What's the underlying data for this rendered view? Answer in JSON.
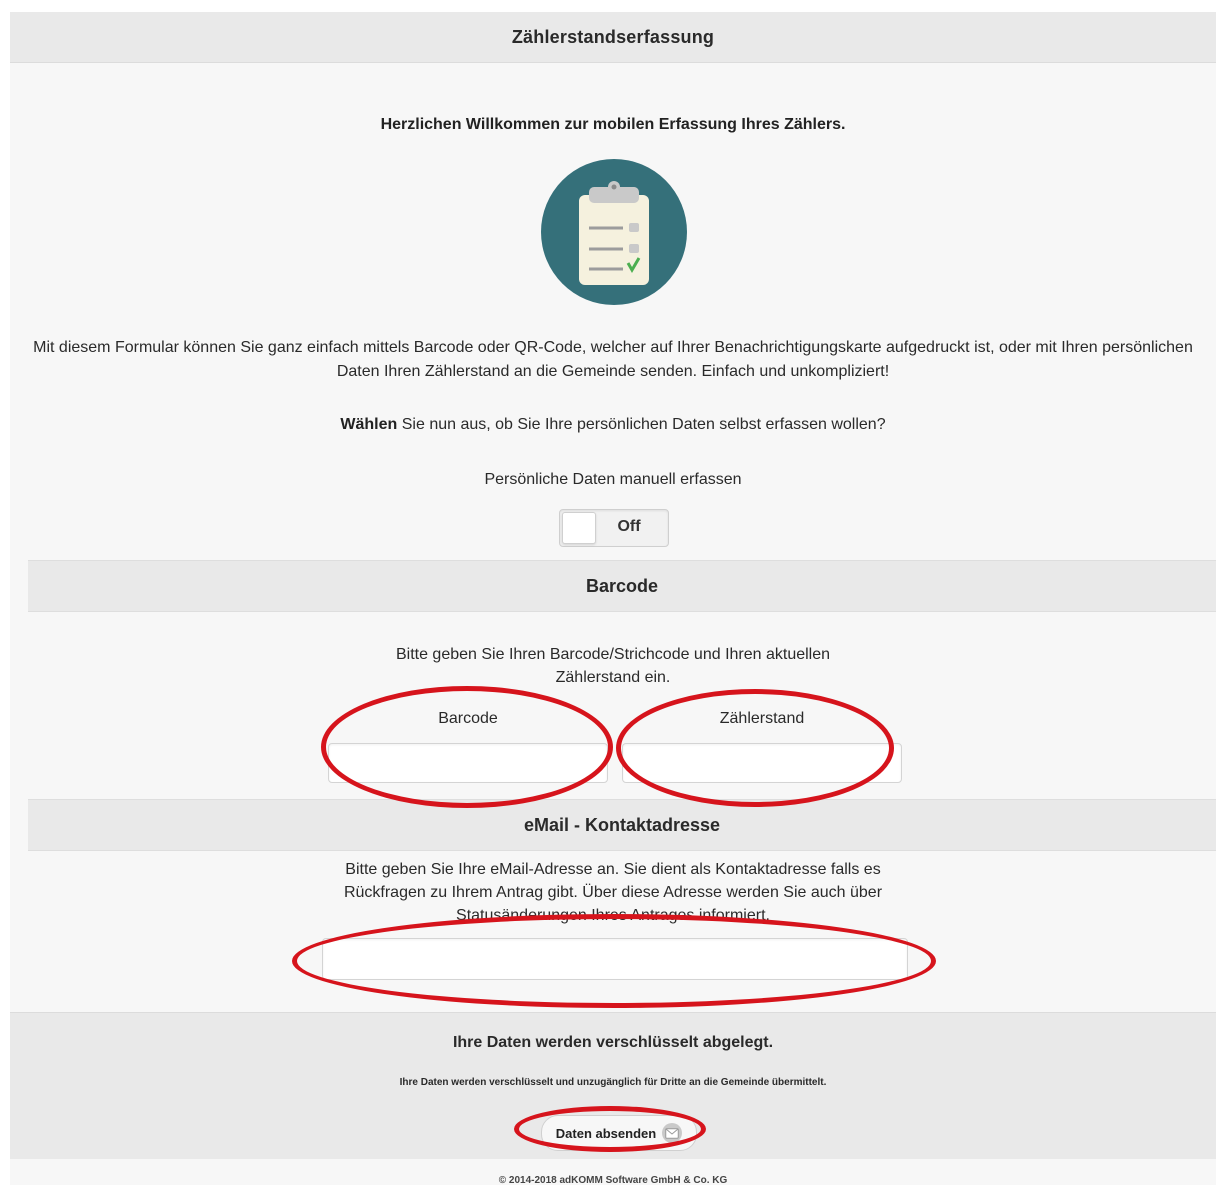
{
  "header": {
    "title": "Zählerstandserfassung"
  },
  "welcome": "Herzlichen Willkommen zur mobilen Erfassung Ihres Zählers.",
  "intro": "Mit diesem Formular können Sie ganz einfach mittels Barcode oder QR-Code, welcher auf Ihrer Benachrichtigungskarte aufgedruckt ist, oder mit Ihren persönlichen Daten Ihren Zählerstand an die Gemeinde senden. Einfach und unkompliziert!",
  "choose": {
    "bold": "Wählen",
    "rest": " Sie nun aus, ob Sie Ihre persönlichen Daten selbst erfassen wollen?"
  },
  "manual_toggle": {
    "label": "Persönliche Daten manuell erfassen",
    "state": "Off"
  },
  "barcode_section": {
    "title": "Barcode",
    "help": "Bitte geben Sie Ihren Barcode/Strichcode und Ihren aktuellen Zählerstand ein.",
    "barcode_label": "Barcode",
    "barcode_value": "",
    "meter_label": "Zählerstand",
    "meter_value": ""
  },
  "email_section": {
    "title": "eMail - Kontaktadresse",
    "help": "Bitte geben Sie Ihre eMail-Adresse an. Sie dient als Kontaktadresse falls es Rückfragen zu Ihrem Antrag gibt. Über diese Adresse werden Sie auch über Statusänderungen Ihres Antrages informiert.",
    "email_value": ""
  },
  "footer": {
    "heading": "Ihre Daten werden verschlüsselt abgelegt.",
    "subtext": "Ihre Daten werden verschlüsselt und unzugänglich für Dritte an die Gemeinde übermittelt.",
    "submit_label": "Daten absenden",
    "submit_icon": "mail-icon"
  },
  "copyright": "© 2014-2018 adKOMM Software GmbH & Co. KG",
  "colors": {
    "icon_bg": "#35707a",
    "annotation": "#d6141c",
    "check": "#4caf50"
  }
}
